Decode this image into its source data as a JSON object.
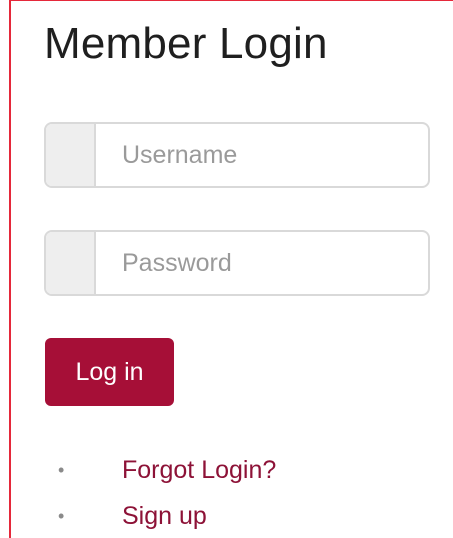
{
  "login": {
    "title": "Member Login",
    "username_placeholder": "Username",
    "password_placeholder": "Password",
    "submit_label": "Log in"
  },
  "links": {
    "bullet": "•",
    "forgot_login": "Forgot Login?",
    "sign_up": "Sign up"
  },
  "colors": {
    "accent": "#a60f37",
    "link": "#8d1237",
    "page_border": "#e5283a",
    "input_border": "#d9d9d9",
    "addon_background": "#eeeeee"
  }
}
